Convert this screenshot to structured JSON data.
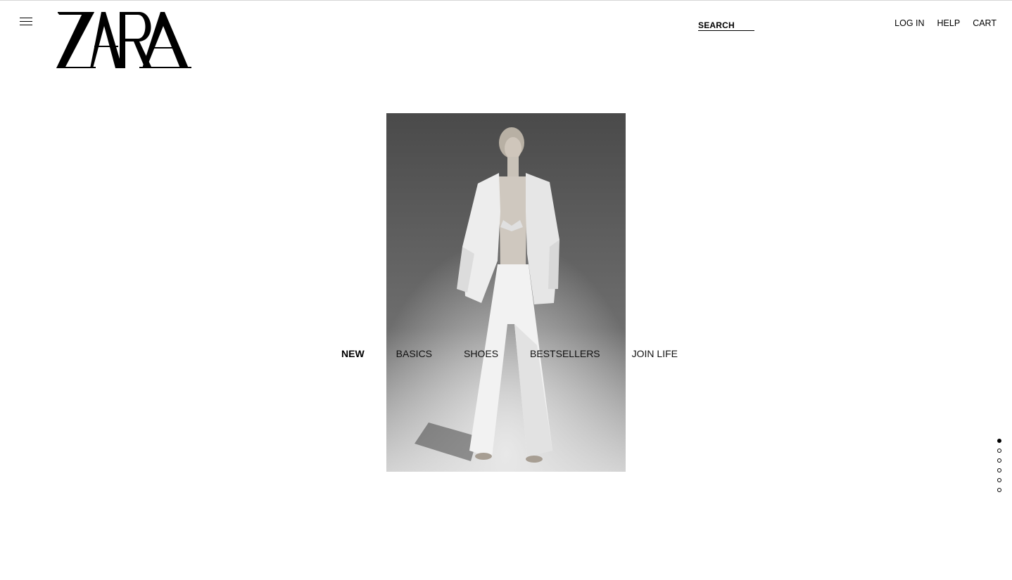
{
  "header": {
    "logo_text": "ZARA",
    "search_label": "SEARCH",
    "links": [
      {
        "label": "LOG IN"
      },
      {
        "label": "HELP"
      },
      {
        "label": "CART"
      }
    ]
  },
  "icons": {
    "menu": "hamburger-menu-icon"
  },
  "hero": {
    "image": "black-and-white photo of model in white blazer and wide trousers"
  },
  "categories": [
    {
      "label": "NEW",
      "active": true
    },
    {
      "label": "BASICS",
      "active": false
    },
    {
      "label": "SHOES",
      "active": false
    },
    {
      "label": "BESTSELLERS",
      "active": false
    },
    {
      "label": "JOIN LIFE",
      "active": false
    }
  ],
  "slider": {
    "total": 6,
    "active_index": 0
  }
}
